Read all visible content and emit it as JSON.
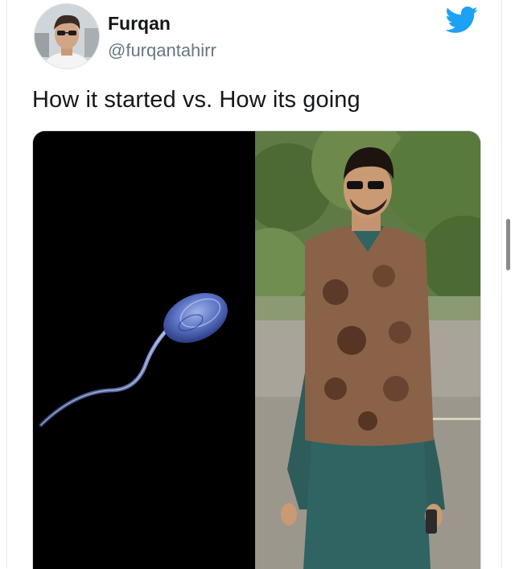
{
  "tweet": {
    "display_name": "Furqan",
    "handle": "@furqantahirr",
    "text": "How it started vs. How its going"
  },
  "icons": {
    "brand": "twitter-bird-icon"
  },
  "colors": {
    "twitter_blue": "#1DA1F2",
    "handle_gray": "#657786",
    "text": "#14171a"
  },
  "media": {
    "left_panel": "sperm-cell-on-black",
    "right_panel": "man-in-green-kurta-and-floral-waistcoat"
  }
}
